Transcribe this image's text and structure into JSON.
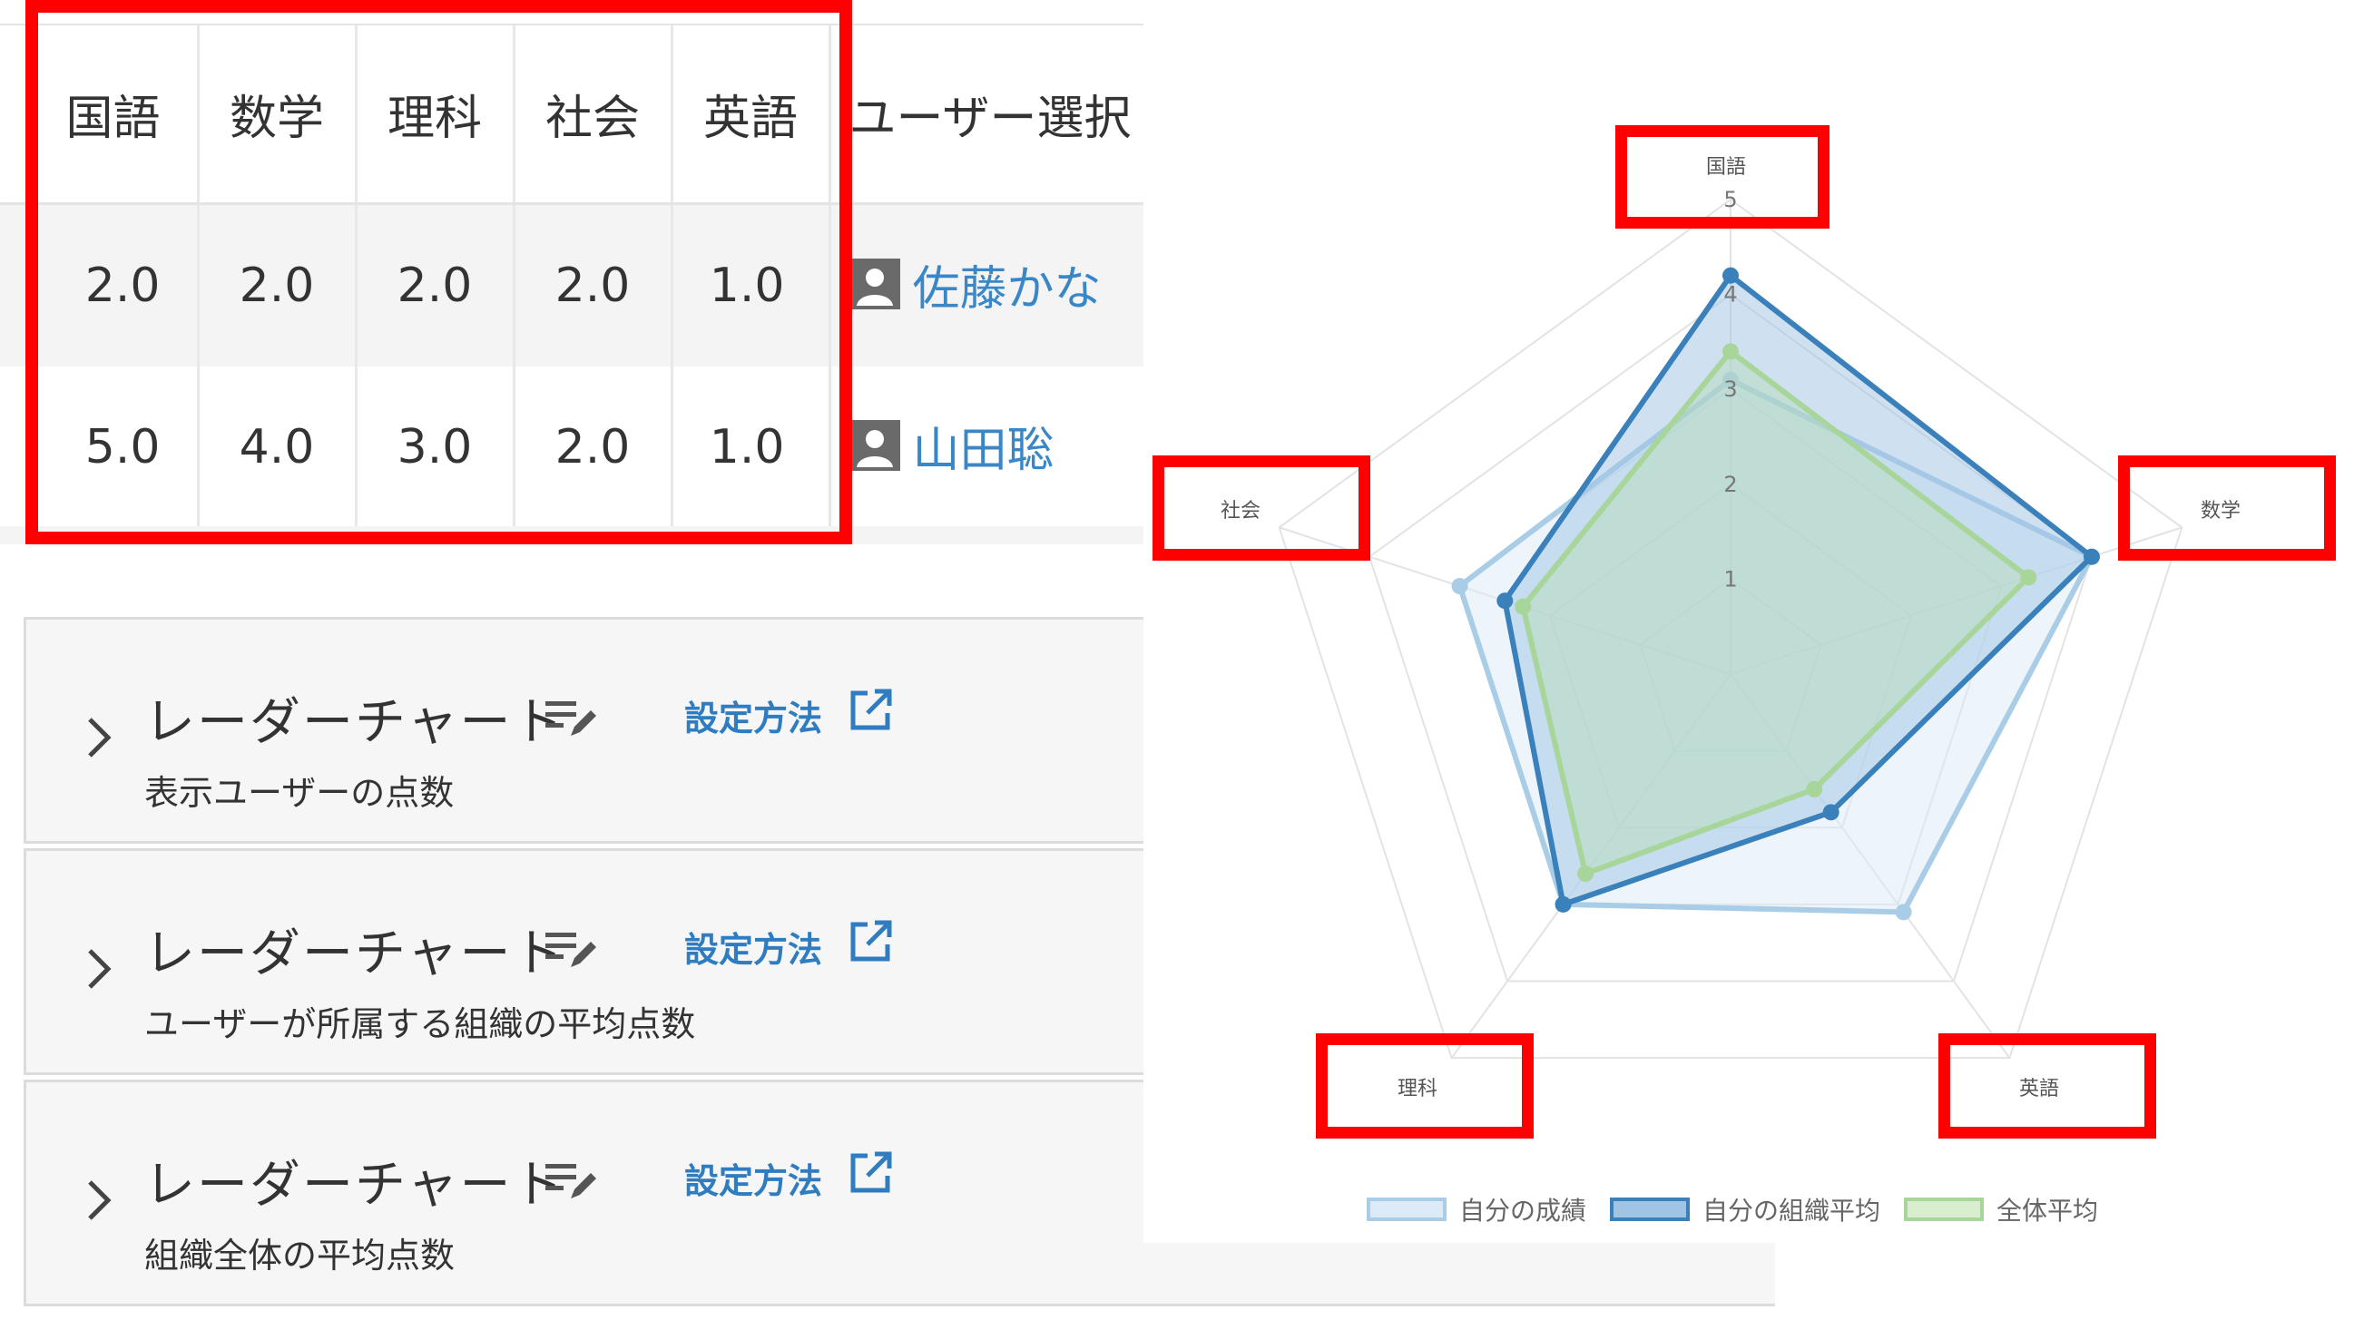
{
  "table": {
    "headers": [
      "国語",
      "数学",
      "理科",
      "社会",
      "英語"
    ],
    "user_header": "ユーザー選択",
    "rows": [
      {
        "values": [
          "2.0",
          "2.0",
          "2.0",
          "2.0",
          "1.0"
        ],
        "user": "佐藤かな"
      },
      {
        "values": [
          "5.0",
          "4.0",
          "3.0",
          "2.0",
          "1.0"
        ],
        "user": "山田聡"
      }
    ]
  },
  "panels": [
    {
      "title": "レーダーチャート",
      "link": "設定方法",
      "desc": "表示ユーザーの点数"
    },
    {
      "title": "レーダーチャート",
      "link": "設定方法",
      "desc": "ユーザーが所属する組織の平均点数"
    },
    {
      "title": "レーダーチャート",
      "link": "設定方法",
      "desc": "組織全体の平均点数"
    }
  ],
  "chart_data": {
    "type": "radar",
    "axes": [
      "国語",
      "数学",
      "英語",
      "理科",
      "社会"
    ],
    "tick_labels": [
      "1",
      "2",
      "3",
      "4",
      "5"
    ],
    "rmax": 5,
    "series": [
      {
        "name": "自分の成績",
        "values": [
          3.1,
          4.0,
          3.1,
          3.0,
          3.0
        ],
        "stroke": "#a9cde6",
        "fill": "#dcebf7"
      },
      {
        "name": "自分の組織平均",
        "values": [
          4.2,
          4.0,
          1.8,
          3.0,
          2.5
        ],
        "stroke": "#3a80bb",
        "fill": "#9fc4e4"
      },
      {
        "name": "全体平均",
        "values": [
          3.4,
          3.3,
          1.5,
          2.6,
          2.3
        ],
        "stroke": "#a8d69a",
        "fill": "#b8dcbc"
      }
    ],
    "colors": {
      "grid": "#e3e3e3",
      "tick": "#777777"
    }
  },
  "colors": {
    "highlight": "#ff0000",
    "link": "#2f7cc0",
    "user_link": "#3a87c8"
  },
  "icons": {
    "user": "user-icon",
    "edit": "edit-icon",
    "external": "external-link-icon",
    "chevron": "chevron-right-icon"
  }
}
